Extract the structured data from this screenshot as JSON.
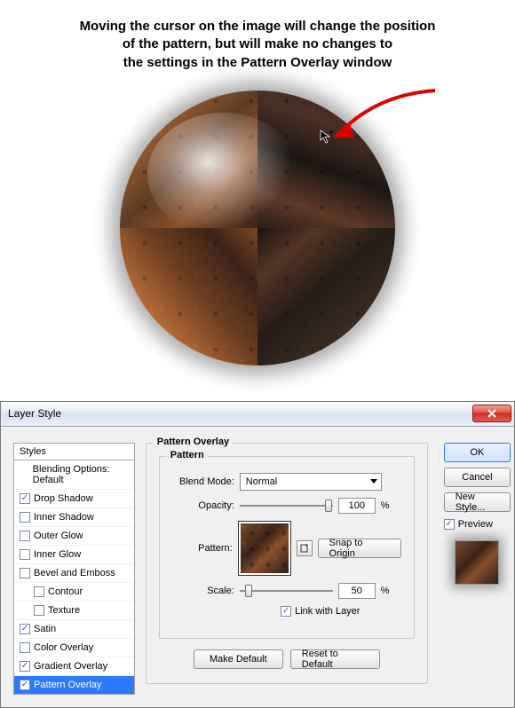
{
  "caption": {
    "line1": "Moving the cursor on the image will change the position",
    "line2": "of the pattern, but will make no changes to",
    "line3": "the settings in the Pattern Overlay window"
  },
  "dialog": {
    "title": "Layer Style",
    "styles_header": "Styles",
    "styles": [
      {
        "label": "Blending Options: Default",
        "checked": null,
        "indent": false,
        "selected": false
      },
      {
        "label": "Drop Shadow",
        "checked": true,
        "indent": false,
        "selected": false
      },
      {
        "label": "Inner Shadow",
        "checked": false,
        "indent": false,
        "selected": false
      },
      {
        "label": "Outer Glow",
        "checked": false,
        "indent": false,
        "selected": false
      },
      {
        "label": "Inner Glow",
        "checked": false,
        "indent": false,
        "selected": false
      },
      {
        "label": "Bevel and Emboss",
        "checked": false,
        "indent": false,
        "selected": false
      },
      {
        "label": "Contour",
        "checked": false,
        "indent": true,
        "selected": false
      },
      {
        "label": "Texture",
        "checked": false,
        "indent": true,
        "selected": false
      },
      {
        "label": "Satin",
        "checked": true,
        "indent": false,
        "selected": false
      },
      {
        "label": "Color Overlay",
        "checked": false,
        "indent": false,
        "selected": false
      },
      {
        "label": "Gradient Overlay",
        "checked": true,
        "indent": false,
        "selected": false
      },
      {
        "label": "Pattern Overlay",
        "checked": true,
        "indent": false,
        "selected": true
      }
    ],
    "section_title": "Pattern Overlay",
    "group_title": "Pattern",
    "labels": {
      "blend_mode": "Blend Mode:",
      "opacity": "Opacity:",
      "pattern": "Pattern:",
      "scale": "Scale:",
      "link": "Link with Layer",
      "percent": "%"
    },
    "values": {
      "blend_mode": "Normal",
      "opacity": "100",
      "scale": "50"
    },
    "buttons": {
      "snap": "Snap to Origin",
      "make_default": "Make Default",
      "reset_default": "Reset to Default",
      "ok": "OK",
      "cancel": "Cancel",
      "new_style": "New Style..."
    },
    "preview_label": "Preview",
    "link_checked": true,
    "preview_checked": true
  }
}
